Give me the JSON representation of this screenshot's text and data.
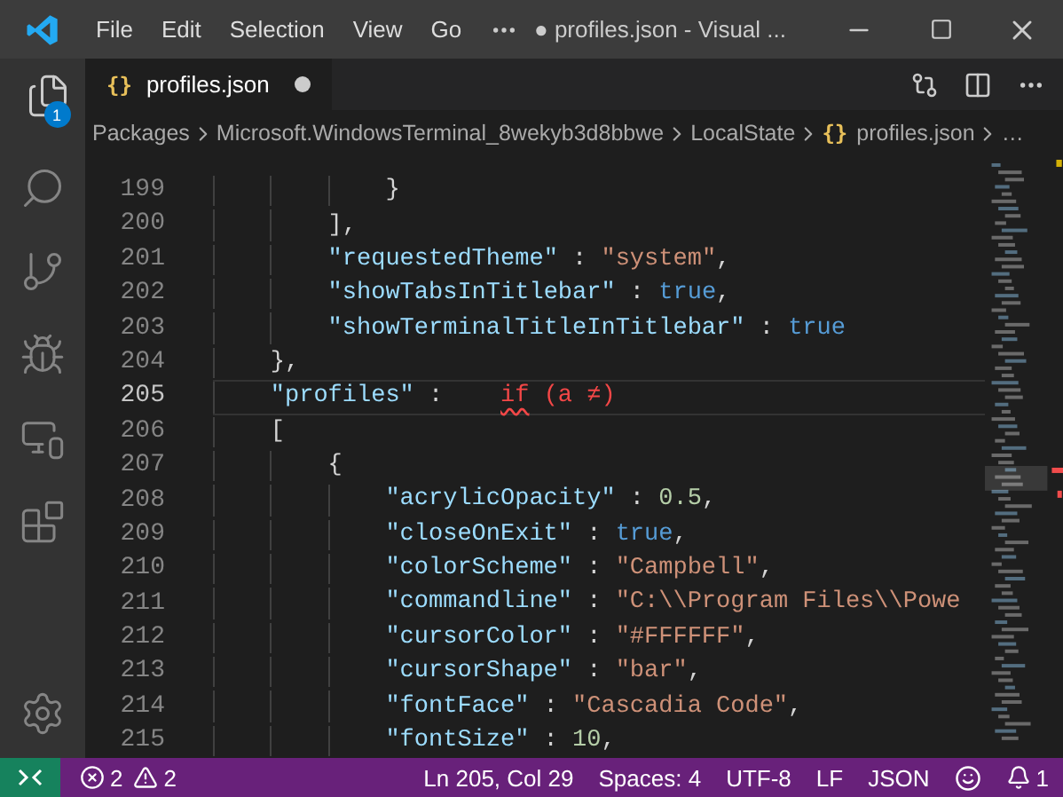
{
  "title_bar": {
    "menus": [
      "File",
      "Edit",
      "Selection",
      "View",
      "Go"
    ],
    "title": "● profiles.json - Visual ..."
  },
  "activity_bar": {
    "explorer_badge": "1"
  },
  "tabs": [
    {
      "icon": "{}",
      "label": "profiles.json",
      "selected": true,
      "dirty": true
    }
  ],
  "breadcrumb": [
    {
      "label": "Packages"
    },
    {
      "label": "Microsoft.WindowsTerminal_8wekyb3d8bbwe"
    },
    {
      "label": "LocalState"
    },
    {
      "icon": "{}",
      "label": "profiles.json"
    },
    {
      "label": "…"
    }
  ],
  "editor": {
    "lines": [
      {
        "children": [
          {
            "children": [
              {
                "number": "199",
                "current": false,
                "tokens": [
                  {
                    "kind": "punct",
                    "text": "}"
                  }
                ]
              }
            ]
          },
          {
            "number": "200",
            "current": false,
            "tokens": [
              {
                "kind": "punct",
                "text": "],"
              }
            ]
          },
          {
            "number": "201",
            "current": false,
            "tokens": [
              {
                "kind": "key",
                "text": "\"requestedTheme\""
              },
              {
                "kind": "punct",
                "text": " : "
              },
              {
                "kind": "string",
                "text": "\"system\""
              },
              {
                "kind": "punct",
                "text": ","
              }
            ]
          },
          {
            "number": "202",
            "current": false,
            "tokens": [
              {
                "kind": "key",
                "text": "\"showTabsInTitlebar\""
              },
              {
                "kind": "punct",
                "text": " : "
              },
              {
                "kind": "bool",
                "text": "true"
              },
              {
                "kind": "punct",
                "text": ","
              }
            ]
          },
          {
            "number": "203",
            "current": false,
            "tokens": [
              {
                "kind": "key",
                "text": "\"showTerminalTitleInTitlebar\""
              },
              {
                "kind": "punct",
                "text": " : "
              },
              {
                "kind": "bool",
                "text": "true"
              }
            ]
          }
        ]
      },
      {
        "number": "204",
        "current": false,
        "tokens": [
          {
            "kind": "punct",
            "text": "},"
          }
        ]
      },
      {
        "number": "205",
        "current": true,
        "tokens": [
          {
            "kind": "key",
            "text": "\"profiles\""
          },
          {
            "kind": "punct",
            "text": " :    "
          },
          {
            "kind": "error",
            "text": "if",
            "squiggle": true
          },
          {
            "kind": "error",
            "text": " (a ≠)"
          }
        ]
      },
      {
        "number": "206",
        "current": false,
        "tokens": [
          {
            "kind": "punct",
            "text": "["
          }
        ]
      },
      {
        "children": [
          {
            "number": "207",
            "current": false,
            "tokens": [
              {
                "kind": "punct",
                "text": "{"
              }
            ]
          },
          {
            "children": [
              {
                "number": "208",
                "current": false,
                "tokens": [
                  {
                    "kind": "key",
                    "text": "\"acrylicOpacity\""
                  },
                  {
                    "kind": "punct",
                    "text": " : "
                  },
                  {
                    "kind": "number",
                    "text": "0.5"
                  },
                  {
                    "kind": "punct",
                    "text": ","
                  }
                ]
              },
              {
                "number": "209",
                "current": false,
                "tokens": [
                  {
                    "kind": "key",
                    "text": "\"closeOnExit\""
                  },
                  {
                    "kind": "punct",
                    "text": " : "
                  },
                  {
                    "kind": "bool",
                    "text": "true"
                  },
                  {
                    "kind": "punct",
                    "text": ","
                  }
                ]
              },
              {
                "number": "210",
                "current": false,
                "tokens": [
                  {
                    "kind": "key",
                    "text": "\"colorScheme\""
                  },
                  {
                    "kind": "punct",
                    "text": " : "
                  },
                  {
                    "kind": "string",
                    "text": "\"Campbell\""
                  },
                  {
                    "kind": "punct",
                    "text": ","
                  }
                ]
              },
              {
                "number": "211",
                "current": false,
                "tokens": [
                  {
                    "kind": "key",
                    "text": "\"commandline\""
                  },
                  {
                    "kind": "punct",
                    "text": " : "
                  },
                  {
                    "kind": "string",
                    "text": "\"C:\\\\Program Files\\\\Powe"
                  }
                ]
              },
              {
                "number": "212",
                "current": false,
                "tokens": [
                  {
                    "kind": "key",
                    "text": "\"cursorColor\""
                  },
                  {
                    "kind": "punct",
                    "text": " : "
                  },
                  {
                    "kind": "string",
                    "text": "\"#FFFFFF\""
                  },
                  {
                    "kind": "punct",
                    "text": ","
                  }
                ]
              },
              {
                "number": "213",
                "current": false,
                "tokens": [
                  {
                    "kind": "key",
                    "text": "\"cursorShape\""
                  },
                  {
                    "kind": "punct",
                    "text": " : "
                  },
                  {
                    "kind": "string",
                    "text": "\"bar\""
                  },
                  {
                    "kind": "punct",
                    "text": ","
                  }
                ]
              },
              {
                "number": "214",
                "current": false,
                "tokens": [
                  {
                    "kind": "key",
                    "text": "\"fontFace\""
                  },
                  {
                    "kind": "punct",
                    "text": " : "
                  },
                  {
                    "kind": "string",
                    "text": "\"Cascadia Code\""
                  },
                  {
                    "kind": "punct",
                    "text": ","
                  }
                ]
              },
              {
                "number": "215",
                "current": false,
                "tokens": [
                  {
                    "kind": "key",
                    "text": "\"fontSize\""
                  },
                  {
                    "kind": "punct",
                    "text": " : "
                  },
                  {
                    "kind": "number",
                    "text": "10"
                  },
                  {
                    "kind": "punct",
                    "text": ","
                  }
                ]
              }
            ]
          }
        ]
      }
    ]
  },
  "status_bar": {
    "errors": "2",
    "warnings": "2",
    "position": "Ln 205, Col 29",
    "indentation": "Spaces: 4",
    "encoding": "UTF-8",
    "eol": "LF",
    "language": "JSON",
    "notifications": "1"
  }
}
